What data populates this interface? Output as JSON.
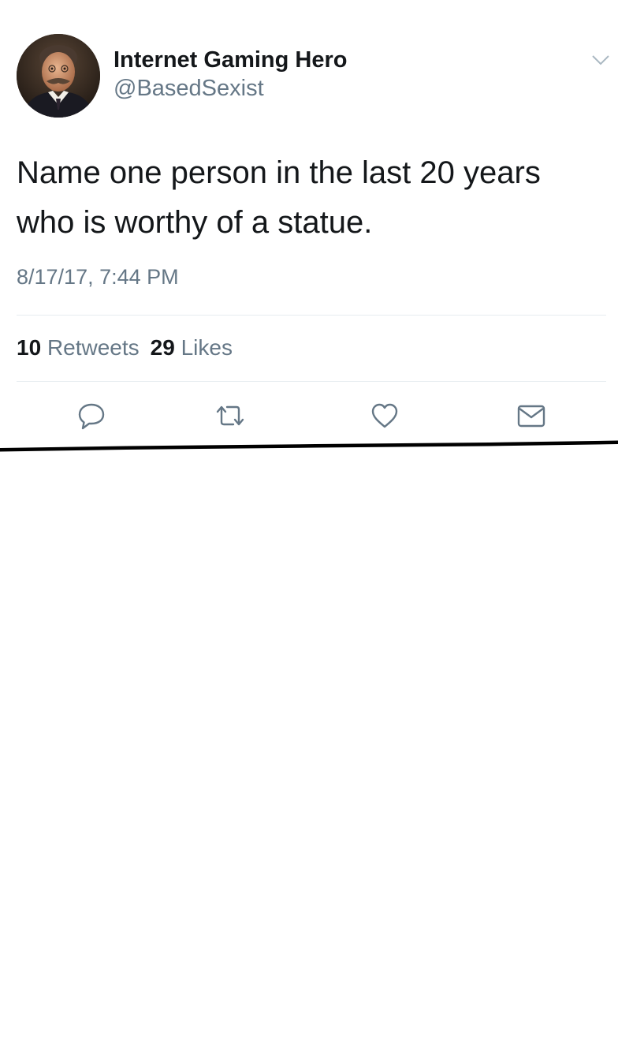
{
  "tweet": {
    "author": {
      "display_name": "Internet Gaming Hero",
      "handle": "@BasedSexist",
      "avatar_icon": "portrait-avatar"
    },
    "menu_icon": "chevron-down-icon",
    "text": "Name one person in the last 20 years who is worthy of a statue.",
    "timestamp": "8/17/17, 7:44 PM",
    "stats": {
      "retweets_count": "10",
      "retweets_label": "Retweets",
      "likes_count": "29",
      "likes_label": "Likes"
    },
    "actions": [
      {
        "name": "reply",
        "icon": "speech-bubble-icon"
      },
      {
        "name": "retweet",
        "icon": "retweet-arrows-icon"
      },
      {
        "name": "like",
        "icon": "heart-icon"
      },
      {
        "name": "direct-message",
        "icon": "envelope-icon"
      }
    ]
  },
  "colors": {
    "text_primary": "#14171a",
    "text_secondary": "#657786",
    "divider": "#e6ecf0",
    "icon": "#657786",
    "cut_line": "#000000",
    "background": "#ffffff"
  }
}
